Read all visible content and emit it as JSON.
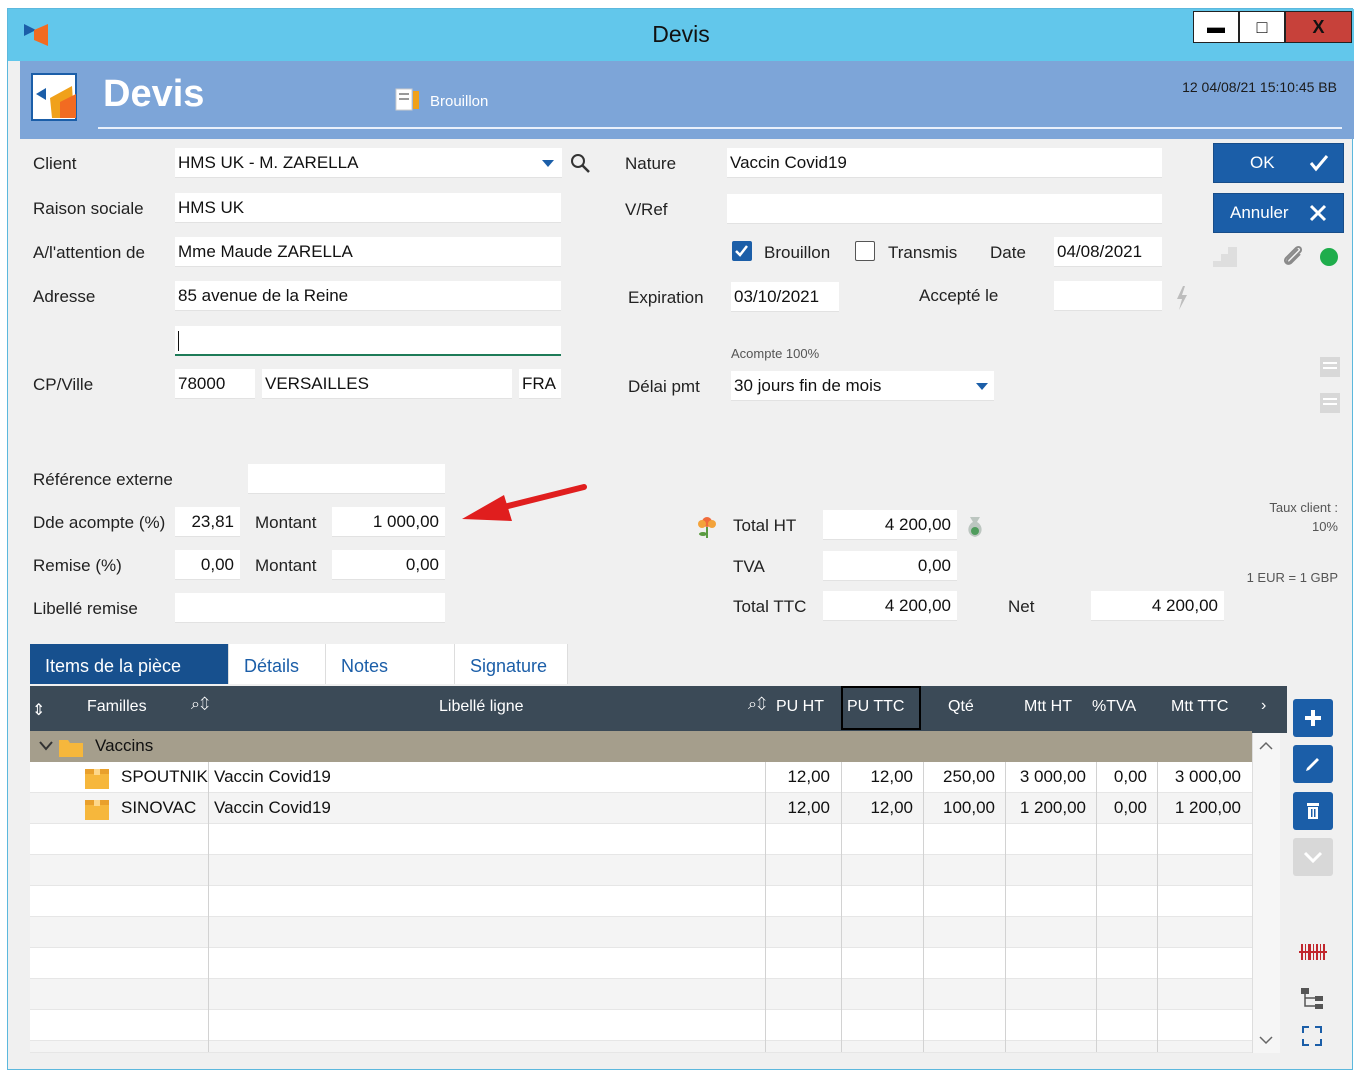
{
  "window": {
    "title": "Devis",
    "controls": {
      "minimize": "▬",
      "maximize": "□",
      "close": "X"
    }
  },
  "header": {
    "title": "Devis",
    "status_label": "Brouillon",
    "meta": "12  04/08/21 15:10:45  BB"
  },
  "form": {
    "client": {
      "label": "Client",
      "value": "HMS UK - M. ZARELLA"
    },
    "raison_sociale": {
      "label": "Raison sociale",
      "value": "HMS UK"
    },
    "attention": {
      "label": "A/l'attention de",
      "value": "Mme Maude ZARELLA"
    },
    "adresse": {
      "label": "Adresse",
      "value": "85 avenue de la Reine",
      "value2": ""
    },
    "cp_ville": {
      "label": "CP/Ville",
      "cp": "78000",
      "ville": "VERSAILLES",
      "pays": "FRA"
    },
    "nature": {
      "label": "Nature",
      "value": "Vaccin Covid19"
    },
    "vref": {
      "label": "V/Ref",
      "value": ""
    },
    "brouillon": {
      "label": "Brouillon",
      "checked": true
    },
    "transmis": {
      "label": "Transmis",
      "checked": false
    },
    "date": {
      "label": "Date",
      "value": "04/08/2021"
    },
    "expiration": {
      "label": "Expiration",
      "value": "03/10/2021"
    },
    "accepte_le": {
      "label": "Accepté le",
      "value": ""
    },
    "acompte_note": "Acompte 100%",
    "delai_pmt": {
      "label": "Délai pmt",
      "value": "30 jours fin de mois"
    },
    "reference_externe": {
      "label": "Référence externe",
      "value": ""
    },
    "dde_acompte": {
      "label": "Dde acompte (%)",
      "value": "23,81",
      "montant_label": "Montant",
      "montant": "1 000,00"
    },
    "remise": {
      "label": "Remise (%)",
      "value": "0,00",
      "montant_label": "Montant",
      "montant": "0,00"
    },
    "libelle_remise": {
      "label": "Libellé remise",
      "value": ""
    }
  },
  "totals": {
    "total_ht": {
      "label": "Total HT",
      "value": "4 200,00"
    },
    "tva": {
      "label": "TVA",
      "value": "0,00"
    },
    "total_ttc": {
      "label": "Total TTC",
      "value": "4 200,00"
    },
    "net": {
      "label": "Net",
      "value": "4 200,00"
    },
    "taux_client": "Taux client :",
    "taux_value": "10%",
    "exchange": "1 EUR = 1 GBP"
  },
  "buttons": {
    "ok": "OK",
    "annuler": "Annuler"
  },
  "tabs": [
    "Items de la pièce",
    "Détails",
    "Notes",
    "Signature"
  ],
  "grid": {
    "columns": [
      "Familles",
      "Libellé ligne",
      "PU HT",
      "PU TTC",
      "Qté",
      "Mtt HT",
      "%TVA",
      "Mtt TTC"
    ],
    "group": "Vaccins",
    "rows": [
      {
        "famille": "SPOUTNIK",
        "libelle": "Vaccin Covid19",
        "pu_ht": "12,00",
        "pu_ttc": "12,00",
        "qte": "250,00",
        "mtt_ht": "3 000,00",
        "tva": "0,00",
        "mtt_ttc": "3 000,00"
      },
      {
        "famille": "SINOVAC",
        "libelle": "Vaccin Covid19",
        "pu_ht": "12,00",
        "pu_ttc": "12,00",
        "qte": "100,00",
        "mtt_ht": "1 200,00",
        "tva": "0,00",
        "mtt_ttc": "1 200,00"
      }
    ]
  },
  "colors": {
    "titlebar": "#62c7eb",
    "header": "#7da5d8",
    "primary": "#1b5ea8",
    "grid_header": "#3b4a57",
    "group_row": "#a59e8c",
    "arrow": "#e01e1e"
  }
}
